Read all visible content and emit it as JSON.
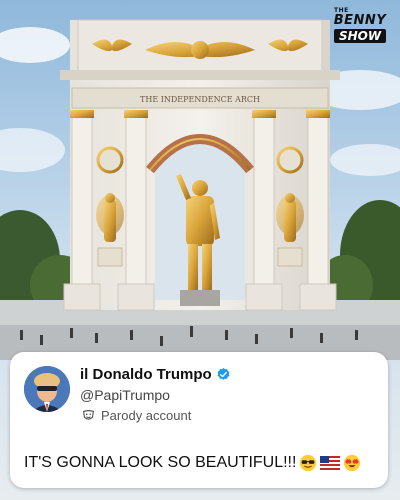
{
  "image": {
    "logo": {
      "line1": "THE",
      "line2": "BENNY",
      "line3": "SHOW"
    },
    "monument_inscription": "THE INDEPENDENCE ARCH"
  },
  "post": {
    "display_name": "il Donaldo Trumpo",
    "handle": "@PapiTrumpo",
    "parody_label": "Parody account",
    "text": "IT'S GONNA LOOK SO BEAUTIFUL!!!",
    "emojis": [
      "sunglasses-face-emoji",
      "us-flag-emoji",
      "heart-eyes-face-emoji"
    ]
  },
  "colors": {
    "verified_badge": "#1d9bf0",
    "gold": "#d9a43a",
    "sky": "#a9c8e0"
  }
}
